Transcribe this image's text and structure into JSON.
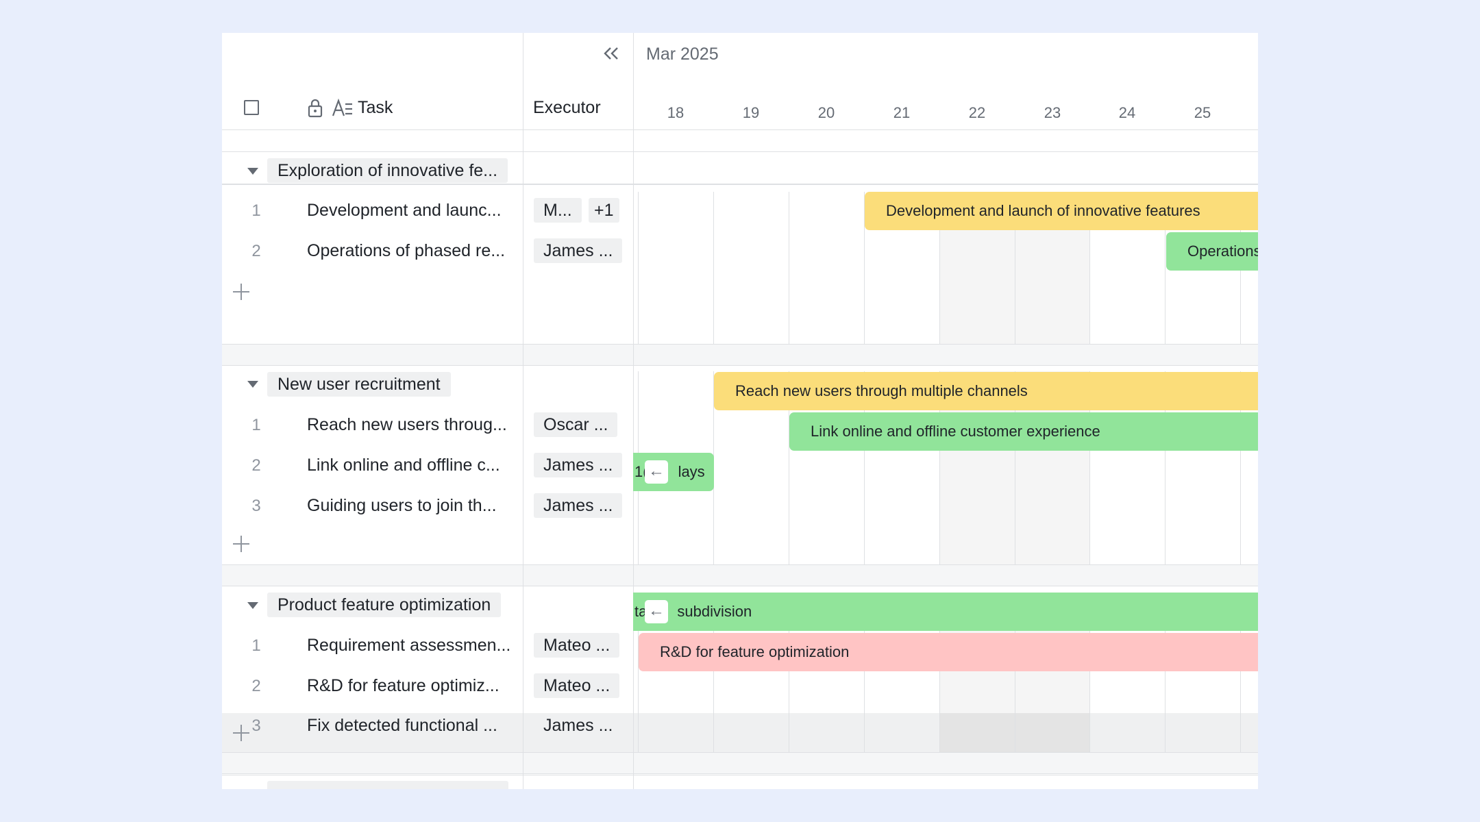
{
  "header": {
    "collapse_icon": "double-chevron-left-icon",
    "month": "Mar 2025",
    "task_label": "Task",
    "executor_label": "Executor",
    "days": [
      "18",
      "19",
      "20",
      "21",
      "22",
      "23",
      "24",
      "25"
    ]
  },
  "groups": [
    {
      "title": "Exploration of innovative fe...",
      "tasks": [
        {
          "idx": "1",
          "name": "Development and launc...",
          "executor": "M...",
          "extra": "+1"
        },
        {
          "idx": "2",
          "name": "Operations of phased re...",
          "executor": "James ..."
        }
      ]
    },
    {
      "title": "New user recruitment",
      "tasks": [
        {
          "idx": "1",
          "name": "Reach new users throug...",
          "executor": "Oscar ..."
        },
        {
          "idx": "2",
          "name": "Link online and offline c...",
          "executor": "James ..."
        },
        {
          "idx": "3",
          "name": "Guiding users to join th...",
          "executor": "James ..."
        }
      ]
    },
    {
      "title": "Product feature optimization",
      "tasks": [
        {
          "idx": "1",
          "name": "Requirement assessmen...",
          "executor": "Mateo ..."
        },
        {
          "idx": "2",
          "name": "R&D for feature optimiz...",
          "executor": "Mateo ..."
        },
        {
          "idx": "3",
          "name": "Fix detected functional ...",
          "executor": "James ..."
        }
      ]
    }
  ],
  "bars": [
    {
      "label": "Development and launch of innovative features",
      "color": "#fbdd7a"
    },
    {
      "label": "Operations",
      "color": "#91e49a"
    },
    {
      "label": "Reach new users through multiple channels",
      "color": "#fbdd7a"
    },
    {
      "label": "Link online and offline customer experience",
      "color": "#91e49a"
    },
    {
      "label": "1(",
      "label2": "lays",
      "color": "#91e49a"
    },
    {
      "label": "ta",
      "label2": "subdivision",
      "color": "#91e49a"
    },
    {
      "label": "R&D for feature optimization",
      "color": "#ffc4c4"
    }
  ],
  "colors": {
    "yellow": "#fbdd7a",
    "green": "#91e49a",
    "pink": "#ffc4c4",
    "background": "#e8eefc"
  }
}
